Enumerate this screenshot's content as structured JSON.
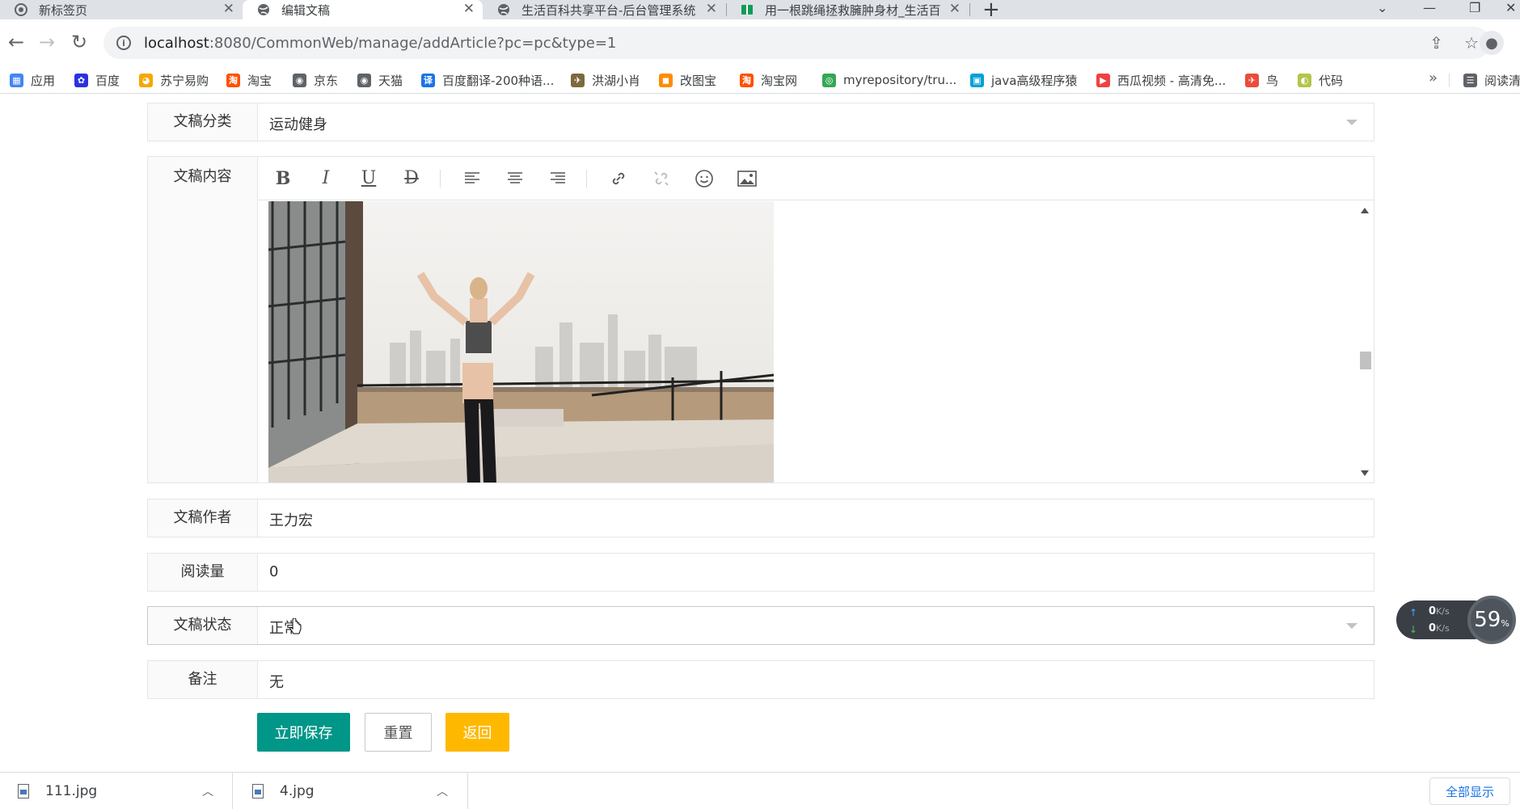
{
  "browser": {
    "tabs": [
      {
        "title": "新标签页",
        "active": false
      },
      {
        "title": "编辑文稿",
        "active": true
      },
      {
        "title": "生活百科共享平台-后台管理系统",
        "active": false
      },
      {
        "title": "用一根跳绳拯救臃肿身材_生活百",
        "active": false
      }
    ],
    "url_host": "localhost",
    "url_rest": ":8080/CommonWeb/manage/addArticle?pc=pc&type=1",
    "bookmarks": [
      {
        "label": "应用",
        "icon": "apps-grid-icon",
        "color": "#4285f4"
      },
      {
        "label": "百度",
        "icon": "baidu-paw-icon",
        "color": "#2932e1"
      },
      {
        "label": "苏宁易购",
        "icon": "suning-icon",
        "color": "#f7a700"
      },
      {
        "label": "淘宝",
        "icon": "taobao-icon",
        "color": "#ff5000"
      },
      {
        "label": "京东",
        "icon": "globe-icon",
        "color": "#5f6368"
      },
      {
        "label": "天猫",
        "icon": "globe-icon",
        "color": "#5f6368"
      },
      {
        "label": "百度翻译-200种语...",
        "icon": "baidu-translate-icon",
        "color": "#1a73e8"
      },
      {
        "label": "洪湖小肖",
        "icon": "bird-icon",
        "color": "#7b6a3d"
      },
      {
        "label": "改图宝",
        "icon": "gaitubao-icon",
        "color": "#ff8c00"
      },
      {
        "label": "淘宝网",
        "icon": "taobao-icon",
        "color": "#ff5000"
      },
      {
        "label": "myrepository/tru...",
        "icon": "chrome-icon",
        "color": "#34a853"
      },
      {
        "label": "java高级程序猿",
        "icon": "bilibili-icon",
        "color": "#00a1d6"
      },
      {
        "label": "西瓜视频 - 高清免...",
        "icon": "xigua-icon",
        "color": "#f04142"
      },
      {
        "label": "鸟",
        "icon": "bird-icon",
        "color": "#e94c3c"
      },
      {
        "label": "代码",
        "icon": "code-icon",
        "color": "#b4c54a"
      },
      {
        "label": "阅读清",
        "icon": "reading-list-icon",
        "color": "#5f6368"
      }
    ]
  },
  "form": {
    "category": {
      "label": "文稿分类",
      "value": "运动健身"
    },
    "content": {
      "label": "文稿内容"
    },
    "author": {
      "label": "文稿作者",
      "value": "王力宏"
    },
    "reads": {
      "label": "阅读量",
      "value": "0"
    },
    "status": {
      "label": "文稿状态",
      "value": "正常"
    },
    "remark": {
      "label": "备注",
      "value": "无"
    },
    "buttons": {
      "save": "立即保存",
      "reset": "重置",
      "back": "返回"
    }
  },
  "editor_tools": [
    "bold-icon",
    "italic-icon",
    "underline-icon",
    "strikethrough-icon",
    "align-left-icon",
    "align-center-icon",
    "align-right-icon",
    "link-icon",
    "unlink-icon",
    "emoji-icon",
    "image-icon"
  ],
  "netspeed": {
    "up": "0",
    "down": "0",
    "unit": "K/s",
    "percent": "59",
    "percent_unit": "%"
  },
  "downloads": {
    "files": [
      "111.jpg",
      "4.jpg"
    ],
    "show_all": "全部显示"
  },
  "colors": {
    "primary": "#009688",
    "warm": "#ffb800"
  }
}
